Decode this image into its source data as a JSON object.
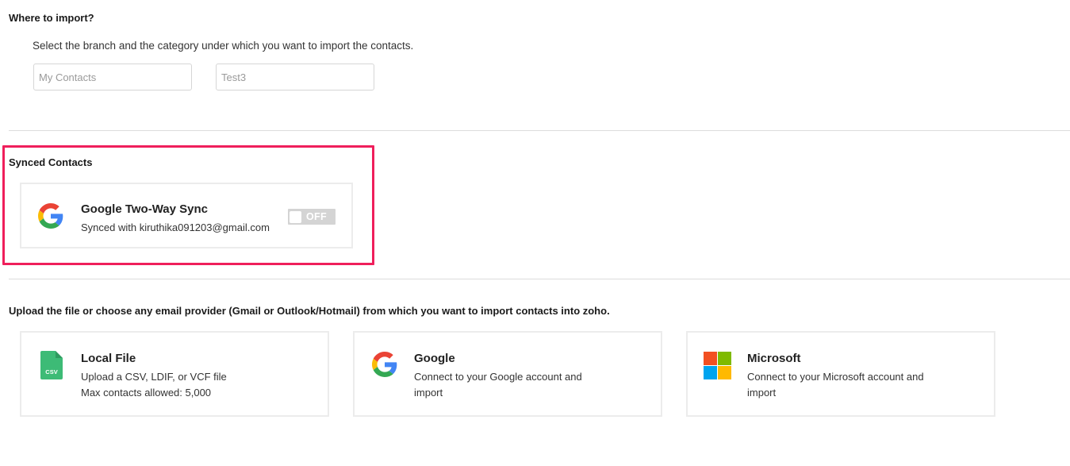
{
  "where_to_import": {
    "heading": "Where to import?",
    "description": "Select the branch and the category under which you want to import the contacts.",
    "branch_field": {
      "value": "My Contacts"
    },
    "category_field": {
      "value": "Test3"
    }
  },
  "synced_contacts": {
    "heading": "Synced Contacts",
    "google_sync": {
      "title": "Google Two-Way Sync",
      "subtitle": "Synced with kiruthika091203@gmail.com",
      "toggle_label": "OFF",
      "enabled": false
    },
    "highlight_color": "#ef1f5b"
  },
  "upload": {
    "heading": "Upload the file or choose any email provider (Gmail or Outlook/Hotmail) from which you want to import contacts into zoho.",
    "options": [
      {
        "title": "Local File",
        "line1": "Upload a CSV, LDIF, or VCF file",
        "line2": "Max contacts allowed: 5,000",
        "icon": "csv-file-icon",
        "icon_text": "CSV"
      },
      {
        "title": "Google",
        "line1": "Connect to your Google account and",
        "line2": "import",
        "icon": "google-icon"
      },
      {
        "title": "Microsoft",
        "line1": "Connect to your Microsoft account and",
        "line2": "import",
        "icon": "microsoft-icon"
      }
    ]
  },
  "colors": {
    "google_blue": "#4285F4",
    "google_red": "#EA4335",
    "google_yellow": "#FBBC05",
    "google_green": "#34A853",
    "ms_red": "#F25022",
    "ms_green": "#7FBA00",
    "ms_blue": "#00A4EF",
    "ms_yellow": "#FFB900",
    "csv_green": "#3dbb76"
  }
}
